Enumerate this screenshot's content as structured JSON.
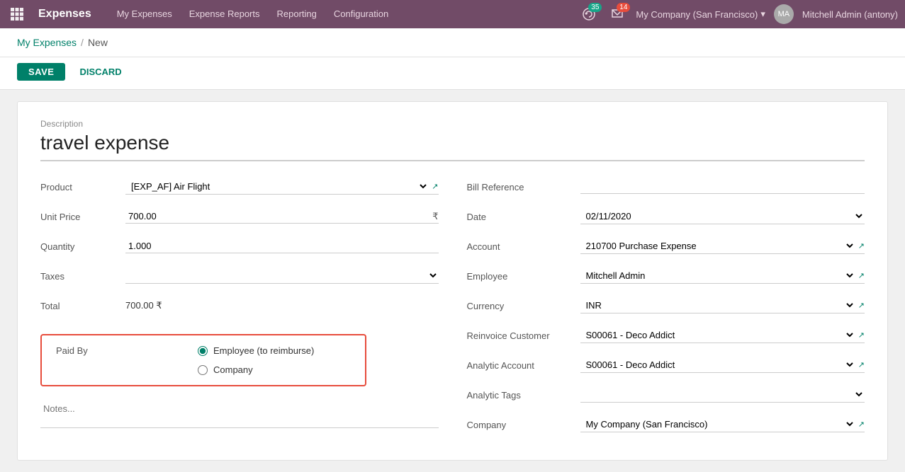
{
  "app": {
    "name": "Expenses"
  },
  "topnav": {
    "menu_items": [
      {
        "label": "My Expenses",
        "key": "my-expenses"
      },
      {
        "label": "Expense Reports",
        "key": "expense-reports"
      },
      {
        "label": "Reporting",
        "key": "reporting"
      },
      {
        "label": "Configuration",
        "key": "configuration"
      }
    ],
    "badge_updates": "35",
    "badge_messages": "14",
    "company": "My Company (San Francisco)",
    "user": "Mitchell Admin (antony)"
  },
  "breadcrumb": {
    "parent": "My Expenses",
    "separator": "/",
    "current": "New"
  },
  "actions": {
    "save": "SAVE",
    "discard": "DISCARD"
  },
  "form": {
    "description_label": "Description",
    "description_value": "travel expense",
    "left": {
      "product_label": "Product",
      "product_value": "[EXP_AF] Air Flight",
      "unit_price_label": "Unit Price",
      "unit_price_value": "700.00",
      "quantity_label": "Quantity",
      "quantity_value": "1.000",
      "taxes_label": "Taxes",
      "taxes_value": "",
      "total_label": "Total",
      "total_value": "700.00 ₹"
    },
    "right": {
      "bill_reference_label": "Bill Reference",
      "bill_reference_value": "",
      "date_label": "Date",
      "date_value": "02/11/2020",
      "account_label": "Account",
      "account_value": "210700 Purchase Expense",
      "employee_label": "Employee",
      "employee_value": "Mitchell Admin",
      "currency_label": "Currency",
      "currency_value": "INR",
      "reinvoice_label": "Reinvoice Customer",
      "reinvoice_value": "S00061 - Deco Addict",
      "analytic_account_label": "Analytic Account",
      "analytic_account_value": "S00061 - Deco Addict",
      "analytic_tags_label": "Analytic Tags",
      "analytic_tags_value": "",
      "company_label": "Company",
      "company_value": "My Company (San Francisco)"
    },
    "paid_by": {
      "label": "Paid By",
      "options": [
        {
          "key": "employee",
          "label": "Employee (to reimburse)",
          "checked": true
        },
        {
          "key": "company",
          "label": "Company",
          "checked": false
        }
      ]
    },
    "notes_placeholder": "Notes..."
  }
}
